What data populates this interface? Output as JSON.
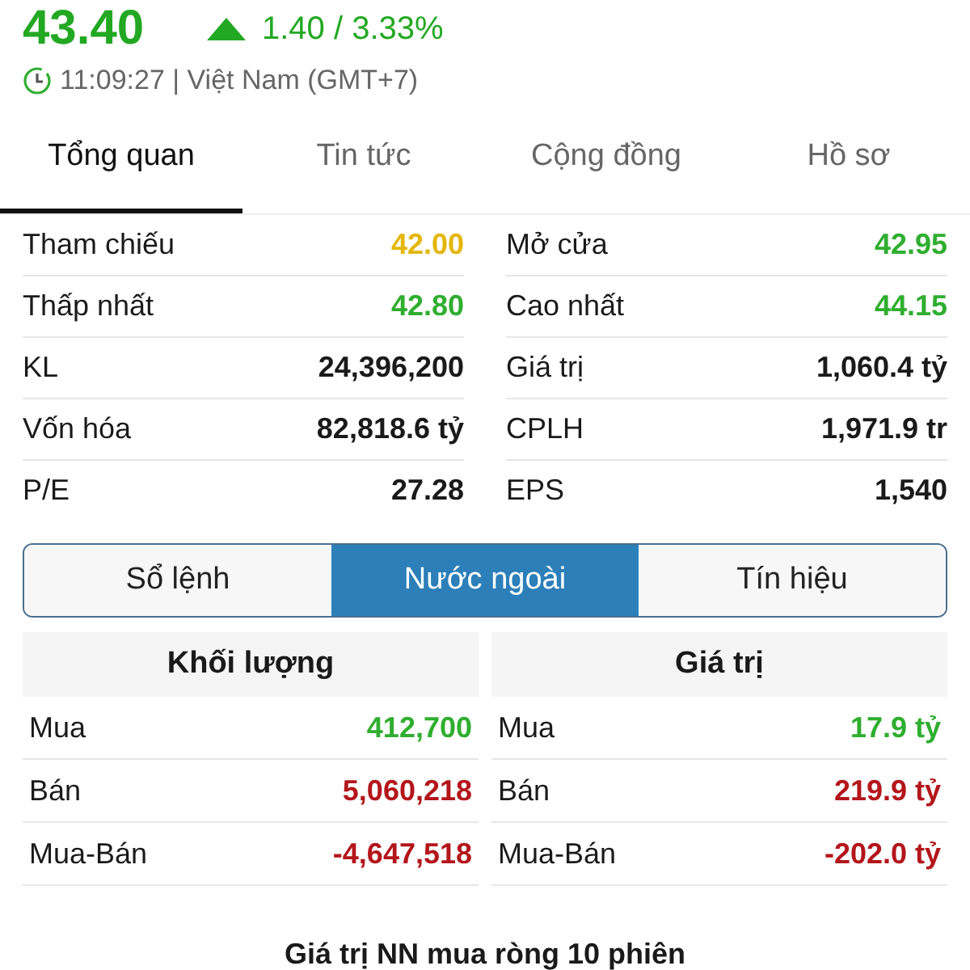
{
  "quote": {
    "price": "43.40",
    "rising": true,
    "change": "1.40 / 3.33%",
    "time": "11:09:27 | Việt Nam (GMT+7)"
  },
  "tabs": [
    {
      "label": "Tổng quan",
      "selected": true
    },
    {
      "label": "Tin tức",
      "selected": false
    },
    {
      "label": "Cộng đồng",
      "selected": false
    },
    {
      "label": "Hồ sơ",
      "selected": false
    }
  ],
  "stats": [
    {
      "left": {
        "label": "Tham chiếu",
        "value": "42.00",
        "color": "#e3b60a"
      },
      "right": {
        "label": "Mở cửa",
        "value": "42.95",
        "color": "#2fae2f"
      }
    },
    {
      "left": {
        "label": "Thấp nhất",
        "value": "42.80",
        "color": "#2fae2f"
      },
      "right": {
        "label": "Cao nhất",
        "value": "44.15",
        "color": "#2fae2f"
      }
    },
    {
      "left": {
        "label": "KL",
        "value": "24,396,200",
        "color": "#1a1a1a"
      },
      "right": {
        "label": "Giá trị",
        "value": "1,060.4 tỷ",
        "color": "#1a1a1a"
      }
    },
    {
      "left": {
        "label": "Vốn hóa",
        "value": "82,818.6 tỷ",
        "color": "#1a1a1a"
      },
      "right": {
        "label": "CPLH",
        "value": "1,971.9 tr",
        "color": "#1a1a1a"
      }
    },
    {
      "left": {
        "label": "P/E",
        "value": "27.28",
        "color": "#1a1a1a"
      },
      "right": {
        "label": "EPS",
        "value": "1,540",
        "color": "#1a1a1a"
      }
    }
  ],
  "segments": [
    {
      "label": "Sổ lệnh",
      "selected": false
    },
    {
      "label": "Nước ngoài",
      "selected": true
    },
    {
      "label": "Tín hiệu",
      "selected": false
    }
  ],
  "foreign": [
    {
      "title": "Khối lượng",
      "rows": [
        {
          "label": "Mua",
          "value": "412,700",
          "color": "#2fae2f"
        },
        {
          "label": "Bán",
          "value": "5,060,218",
          "color": "#b3161b"
        },
        {
          "label": "Mua-Bán",
          "value": "-4,647,518",
          "color": "#b3161b"
        }
      ]
    },
    {
      "title": "Giá trị",
      "rows": [
        {
          "label": "Mua",
          "value": "17.9 tỷ",
          "color": "#2fae2f"
        },
        {
          "label": "Bán",
          "value": "219.9 tỷ",
          "color": "#b3161b"
        },
        {
          "label": "Mua-Bán",
          "value": "-202.0 tỷ",
          "color": "#b3161b"
        }
      ]
    }
  ],
  "section_title": "Giá trị NN mua ròng 10 phiên"
}
